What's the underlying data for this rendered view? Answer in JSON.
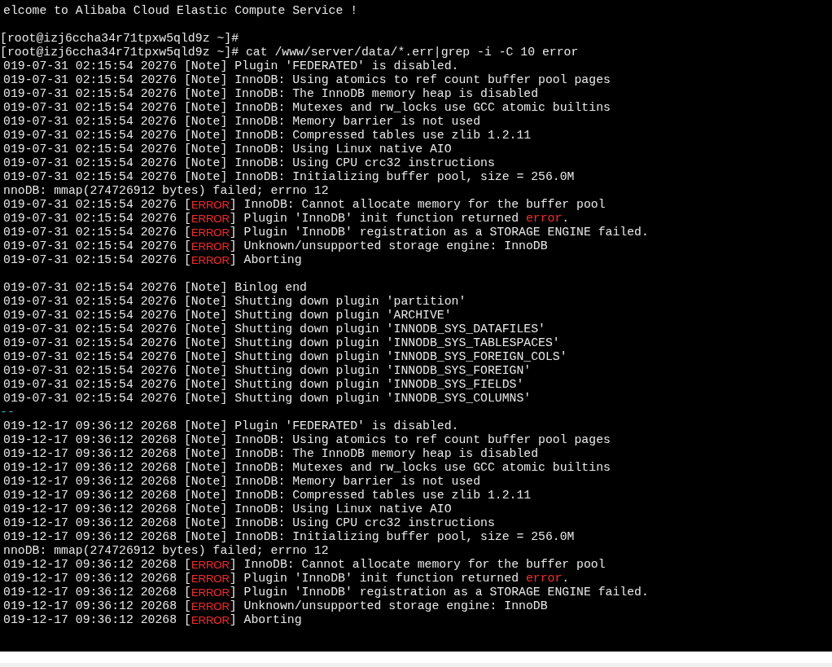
{
  "terminal": {
    "lines": [
      {
        "kind": "text",
        "clipped": true,
        "segments": [
          {
            "kind": "plain",
            "text": "elcome to Alibaba Cloud Elastic Compute Service !"
          }
        ]
      },
      {
        "kind": "blank"
      },
      {
        "kind": "text",
        "clipped": false,
        "segments": [
          {
            "kind": "plain",
            "text": "[root@izj6ccha34r71tpxw5qld9z ~]#"
          }
        ]
      },
      {
        "kind": "text",
        "clipped": false,
        "segments": [
          {
            "kind": "plain",
            "text": "[root@izj6ccha34r71tpxw5qld9z ~]# cat /www/server/data/*.err|grep -i -C 10 error"
          }
        ]
      },
      {
        "kind": "text",
        "clipped": true,
        "segments": [
          {
            "kind": "plain",
            "text": "019-07-31 02:15:54 20276 [Note] Plugin 'FEDERATED' is disabled."
          }
        ]
      },
      {
        "kind": "text",
        "clipped": true,
        "segments": [
          {
            "kind": "plain",
            "text": "019-07-31 02:15:54 20276 [Note] InnoDB: Using atomics to ref count buffer pool pages"
          }
        ]
      },
      {
        "kind": "text",
        "clipped": true,
        "segments": [
          {
            "kind": "plain",
            "text": "019-07-31 02:15:54 20276 [Note] InnoDB: The InnoDB memory heap is disabled"
          }
        ]
      },
      {
        "kind": "text",
        "clipped": true,
        "segments": [
          {
            "kind": "plain",
            "text": "019-07-31 02:15:54 20276 [Note] InnoDB: Mutexes and rw_locks use GCC atomic builtins"
          }
        ]
      },
      {
        "kind": "text",
        "clipped": true,
        "segments": [
          {
            "kind": "plain",
            "text": "019-07-31 02:15:54 20276 [Note] InnoDB: Memory barrier is not used"
          }
        ]
      },
      {
        "kind": "text",
        "clipped": true,
        "segments": [
          {
            "kind": "plain",
            "text": "019-07-31 02:15:54 20276 [Note] InnoDB: Compressed tables use zlib 1.2.11"
          }
        ]
      },
      {
        "kind": "text",
        "clipped": true,
        "segments": [
          {
            "kind": "plain",
            "text": "019-07-31 02:15:54 20276 [Note] InnoDB: Using Linux native AIO"
          }
        ]
      },
      {
        "kind": "text",
        "clipped": true,
        "segments": [
          {
            "kind": "plain",
            "text": "019-07-31 02:15:54 20276 [Note] InnoDB: Using CPU crc32 instructions"
          }
        ]
      },
      {
        "kind": "text",
        "clipped": true,
        "segments": [
          {
            "kind": "plain",
            "text": "019-07-31 02:15:54 20276 [Note] InnoDB: Initializing buffer pool, size = 256.0M"
          }
        ]
      },
      {
        "kind": "text",
        "clipped": true,
        "segments": [
          {
            "kind": "plain",
            "text": "nnoDB: mmap(274726912 bytes) failed; errno 12"
          }
        ]
      },
      {
        "kind": "text",
        "clipped": true,
        "segments": [
          {
            "kind": "plain",
            "text": "019-07-31 02:15:54 20276 ["
          },
          {
            "kind": "tag",
            "text": "ERROR"
          },
          {
            "kind": "plain",
            "text": "] InnoDB: Cannot allocate memory for the buffer pool"
          }
        ]
      },
      {
        "kind": "text",
        "clipped": true,
        "segments": [
          {
            "kind": "plain",
            "text": "019-07-31 02:15:54 20276 ["
          },
          {
            "kind": "tag",
            "text": "ERROR"
          },
          {
            "kind": "plain",
            "text": "] Plugin 'InnoDB' init function returned "
          },
          {
            "kind": "match",
            "text": "error"
          },
          {
            "kind": "plain",
            "text": "."
          }
        ]
      },
      {
        "kind": "text",
        "clipped": true,
        "segments": [
          {
            "kind": "plain",
            "text": "019-07-31 02:15:54 20276 ["
          },
          {
            "kind": "tag",
            "text": "ERROR"
          },
          {
            "kind": "plain",
            "text": "] Plugin 'InnoDB' registration as a STORAGE ENGINE failed."
          }
        ]
      },
      {
        "kind": "text",
        "clipped": true,
        "segments": [
          {
            "kind": "plain",
            "text": "019-07-31 02:15:54 20276 ["
          },
          {
            "kind": "tag",
            "text": "ERROR"
          },
          {
            "kind": "plain",
            "text": "] Unknown/unsupported storage engine: InnoDB"
          }
        ]
      },
      {
        "kind": "text",
        "clipped": true,
        "segments": [
          {
            "kind": "plain",
            "text": "019-07-31 02:15:54 20276 ["
          },
          {
            "kind": "tag",
            "text": "ERROR"
          },
          {
            "kind": "plain",
            "text": "] Aborting"
          }
        ]
      },
      {
        "kind": "blank"
      },
      {
        "kind": "text",
        "clipped": true,
        "segments": [
          {
            "kind": "plain",
            "text": "019-07-31 02:15:54 20276 [Note] Binlog end"
          }
        ]
      },
      {
        "kind": "text",
        "clipped": true,
        "segments": [
          {
            "kind": "plain",
            "text": "019-07-31 02:15:54 20276 [Note] Shutting down plugin 'partition'"
          }
        ]
      },
      {
        "kind": "text",
        "clipped": true,
        "segments": [
          {
            "kind": "plain",
            "text": "019-07-31 02:15:54 20276 [Note] Shutting down plugin 'ARCHIVE'"
          }
        ]
      },
      {
        "kind": "text",
        "clipped": true,
        "segments": [
          {
            "kind": "plain",
            "text": "019-07-31 02:15:54 20276 [Note] Shutting down plugin 'INNODB_SYS_DATAFILES'"
          }
        ]
      },
      {
        "kind": "text",
        "clipped": true,
        "segments": [
          {
            "kind": "plain",
            "text": "019-07-31 02:15:54 20276 [Note] Shutting down plugin 'INNODB_SYS_TABLESPACES'"
          }
        ]
      },
      {
        "kind": "text",
        "clipped": true,
        "segments": [
          {
            "kind": "plain",
            "text": "019-07-31 02:15:54 20276 [Note] Shutting down plugin 'INNODB_SYS_FOREIGN_COLS'"
          }
        ]
      },
      {
        "kind": "text",
        "clipped": true,
        "segments": [
          {
            "kind": "plain",
            "text": "019-07-31 02:15:54 20276 [Note] Shutting down plugin 'INNODB_SYS_FOREIGN'"
          }
        ]
      },
      {
        "kind": "text",
        "clipped": true,
        "segments": [
          {
            "kind": "plain",
            "text": "019-07-31 02:15:54 20276 [Note] Shutting down plugin 'INNODB_SYS_FIELDS'"
          }
        ]
      },
      {
        "kind": "text",
        "clipped": true,
        "segments": [
          {
            "kind": "plain",
            "text": "019-07-31 02:15:54 20276 [Note] Shutting down plugin 'INNODB_SYS_COLUMNS'"
          }
        ]
      },
      {
        "kind": "text",
        "clipped": false,
        "segments": [
          {
            "kind": "separator",
            "text": "--"
          }
        ]
      },
      {
        "kind": "text",
        "clipped": true,
        "segments": [
          {
            "kind": "plain",
            "text": "019-12-17 09:36:12 20268 [Note] Plugin 'FEDERATED' is disabled."
          }
        ]
      },
      {
        "kind": "text",
        "clipped": true,
        "segments": [
          {
            "kind": "plain",
            "text": "019-12-17 09:36:12 20268 [Note] InnoDB: Using atomics to ref count buffer pool pages"
          }
        ]
      },
      {
        "kind": "text",
        "clipped": true,
        "segments": [
          {
            "kind": "plain",
            "text": "019-12-17 09:36:12 20268 [Note] InnoDB: The InnoDB memory heap is disabled"
          }
        ]
      },
      {
        "kind": "text",
        "clipped": true,
        "segments": [
          {
            "kind": "plain",
            "text": "019-12-17 09:36:12 20268 [Note] InnoDB: Mutexes and rw_locks use GCC atomic builtins"
          }
        ]
      },
      {
        "kind": "text",
        "clipped": true,
        "segments": [
          {
            "kind": "plain",
            "text": "019-12-17 09:36:12 20268 [Note] InnoDB: Memory barrier is not used"
          }
        ]
      },
      {
        "kind": "text",
        "clipped": true,
        "segments": [
          {
            "kind": "plain",
            "text": "019-12-17 09:36:12 20268 [Note] InnoDB: Compressed tables use zlib 1.2.11"
          }
        ]
      },
      {
        "kind": "text",
        "clipped": true,
        "segments": [
          {
            "kind": "plain",
            "text": "019-12-17 09:36:12 20268 [Note] InnoDB: Using Linux native AIO"
          }
        ]
      },
      {
        "kind": "text",
        "clipped": true,
        "segments": [
          {
            "kind": "plain",
            "text": "019-12-17 09:36:12 20268 [Note] InnoDB: Using CPU crc32 instructions"
          }
        ]
      },
      {
        "kind": "text",
        "clipped": true,
        "segments": [
          {
            "kind": "plain",
            "text": "019-12-17 09:36:12 20268 [Note] InnoDB: Initializing buffer pool, size = 256.0M"
          }
        ]
      },
      {
        "kind": "text",
        "clipped": true,
        "segments": [
          {
            "kind": "plain",
            "text": "nnoDB: mmap(274726912 bytes) failed; errno 12"
          }
        ]
      },
      {
        "kind": "text",
        "clipped": true,
        "segments": [
          {
            "kind": "plain",
            "text": "019-12-17 09:36:12 20268 ["
          },
          {
            "kind": "tag",
            "text": "ERROR"
          },
          {
            "kind": "plain",
            "text": "] InnoDB: Cannot allocate memory for the buffer pool"
          }
        ]
      },
      {
        "kind": "text",
        "clipped": true,
        "segments": [
          {
            "kind": "plain",
            "text": "019-12-17 09:36:12 20268 ["
          },
          {
            "kind": "tag",
            "text": "ERROR"
          },
          {
            "kind": "plain",
            "text": "] Plugin 'InnoDB' init function returned "
          },
          {
            "kind": "match",
            "text": "error"
          },
          {
            "kind": "plain",
            "text": "."
          }
        ]
      },
      {
        "kind": "text",
        "clipped": true,
        "segments": [
          {
            "kind": "plain",
            "text": "019-12-17 09:36:12 20268 ["
          },
          {
            "kind": "tag",
            "text": "ERROR"
          },
          {
            "kind": "plain",
            "text": "] Plugin 'InnoDB' registration as a STORAGE ENGINE failed."
          }
        ]
      },
      {
        "kind": "text",
        "clipped": true,
        "segments": [
          {
            "kind": "plain",
            "text": "019-12-17 09:36:12 20268 ["
          },
          {
            "kind": "tag",
            "text": "ERROR"
          },
          {
            "kind": "plain",
            "text": "] Unknown/unsupported storage engine: InnoDB"
          }
        ]
      },
      {
        "kind": "text",
        "clipped": true,
        "segments": [
          {
            "kind": "plain",
            "text": "019-12-17 09:36:12 20268 ["
          },
          {
            "kind": "tag",
            "text": "ERROR"
          },
          {
            "kind": "plain",
            "text": "] Aborting"
          }
        ]
      }
    ]
  }
}
